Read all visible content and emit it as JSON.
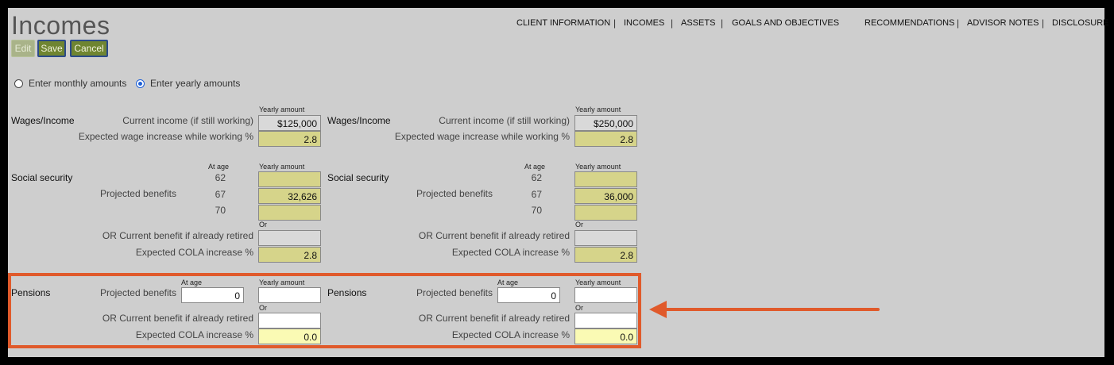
{
  "page": {
    "title": "Incomes"
  },
  "toolbar": {
    "edit_label": "Edit",
    "save_label": "Save",
    "cancel_label": "Cancel"
  },
  "nav": {
    "items": [
      "CLIENT INFORMATION",
      "INCOMES",
      "ASSETS",
      "GOALS AND OBJECTIVES",
      "RECOMMENDATIONS",
      "ADVISOR NOTES",
      "DISCLOSURE"
    ],
    "separator": "|"
  },
  "entry_mode": {
    "monthly_label": "Enter monthly amounts",
    "yearly_label": "Enter yearly amounts",
    "selected": "yearly"
  },
  "labels": {
    "yearly_amount": "Yearly amount",
    "at_age": "At age",
    "or": "Or",
    "wages_section": "Wages/Income",
    "current_income": "Current income (if still working)",
    "wage_increase": "Expected wage increase while working %",
    "social_security_section": "Social security",
    "projected_benefits": "Projected benefits",
    "current_benefit_retired": "OR Current benefit if already retired",
    "cola_increase": "Expected COLA increase %",
    "pensions_section": "Pensions",
    "ages": [
      "62",
      "67",
      "70"
    ]
  },
  "clients": [
    {
      "current_income": "$125,000",
      "wage_increase": "2.8",
      "ss_62": "",
      "ss_67": "32,626",
      "ss_70": "",
      "ss_current_benefit": "",
      "ss_cola": "2.8",
      "pension_age": "0",
      "pension_amount": "",
      "pension_current_benefit": "",
      "pension_cola": "0.0"
    },
    {
      "current_income": "$250,000",
      "wage_increase": "2.8",
      "ss_62": "",
      "ss_67": "36,000",
      "ss_70": "",
      "ss_current_benefit": "",
      "ss_cola": "2.8",
      "pension_age": "0",
      "pension_amount": "",
      "pension_current_benefit": "",
      "pension_cola": "0.0"
    }
  ],
  "annotation": {
    "highlight_color": "#e05a2b"
  }
}
